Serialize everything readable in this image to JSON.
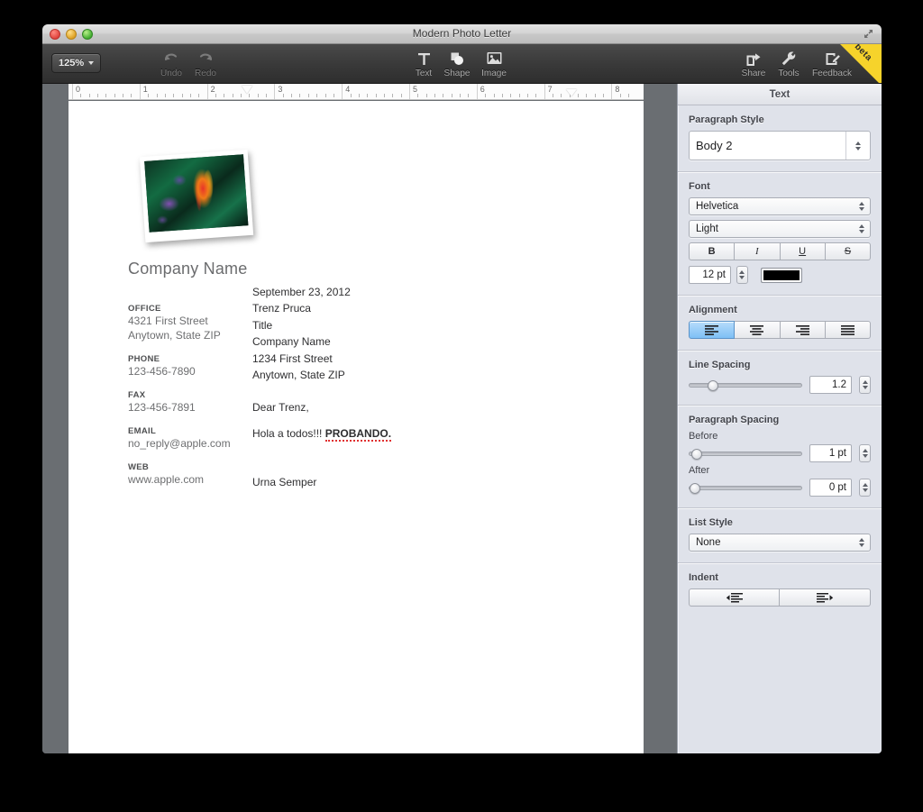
{
  "window": {
    "title": "Modern Photo Letter",
    "traffic_lights": [
      "close",
      "minimize",
      "zoom"
    ],
    "fullscreen_icon": "fullscreen-icon"
  },
  "toolbar": {
    "zoom_level": "125%",
    "items": [
      {
        "label": "Undo",
        "icon": "undo-icon",
        "enabled": false
      },
      {
        "label": "Redo",
        "icon": "redo-icon",
        "enabled": false
      },
      {
        "label": "Text",
        "icon": "text-icon",
        "enabled": true
      },
      {
        "label": "Shape",
        "icon": "shape-icon",
        "enabled": true
      },
      {
        "label": "Image",
        "icon": "image-icon",
        "enabled": true
      },
      {
        "label": "Share",
        "icon": "share-icon",
        "enabled": true
      },
      {
        "label": "Tools",
        "icon": "wrench-icon",
        "enabled": true
      },
      {
        "label": "Feedback",
        "icon": "feedback-icon",
        "enabled": true
      }
    ],
    "beta_badge": "beta"
  },
  "ruler": {
    "numbers": [
      "0",
      "1",
      "2",
      "3",
      "4",
      "5",
      "6",
      "7",
      "8"
    ],
    "first_line_indent_at": 2.6,
    "right_indent_at": 7.4
  },
  "document": {
    "photo_alt": "tropical-flower-photo",
    "company_name": "Company Name",
    "contact_blocks": [
      {
        "label": "OFFICE",
        "lines": [
          "4321 First Street",
          "Anytown, State ZIP"
        ]
      },
      {
        "label": "PHONE",
        "lines": [
          "123-456-7890"
        ]
      },
      {
        "label": "FAX",
        "lines": [
          "123-456-7891"
        ]
      },
      {
        "label": "EMAIL",
        "lines": [
          "no_reply@apple.com"
        ]
      },
      {
        "label": "WEB",
        "lines": [
          "www.apple.com"
        ]
      }
    ],
    "body": {
      "address_lines": [
        "September 23, 2012",
        "Trenz Pruca",
        "Title",
        "Company Name",
        "1234 First Street",
        "Anytown, State ZIP"
      ],
      "salutation": "Dear Trenz,",
      "paragraph_plain": "Hola a todos!!! ",
      "paragraph_bold_misspelled": "PROBANDO.",
      "signature": "Urna Semper"
    }
  },
  "sidebar": {
    "header": "Text",
    "paragraph_style": {
      "title": "Paragraph Style",
      "value": "Body 2"
    },
    "font": {
      "title": "Font",
      "family": "Helvetica",
      "weight": "Light",
      "styles": [
        {
          "name": "bold",
          "label": "B"
        },
        {
          "name": "italic",
          "label": "I"
        },
        {
          "name": "underline",
          "label": "U"
        },
        {
          "name": "strikethrough",
          "label": "S"
        }
      ],
      "size": "12 pt",
      "color": "#000000"
    },
    "alignment": {
      "title": "Alignment",
      "options": [
        "align-left",
        "align-center",
        "align-right",
        "align-justify"
      ],
      "selected": "align-left"
    },
    "line_spacing": {
      "title": "Line Spacing",
      "value": "1.2",
      "slider_percent": 18
    },
    "paragraph_spacing": {
      "title": "Paragraph Spacing",
      "before_label": "Before",
      "before_value": "1 pt",
      "before_percent": 2,
      "after_label": "After",
      "after_value": "0 pt",
      "after_percent": 0
    },
    "list_style": {
      "title": "List Style",
      "value": "None"
    },
    "indent": {
      "title": "Indent",
      "decrease": "decrease-indent",
      "increase": "increase-indent"
    }
  }
}
